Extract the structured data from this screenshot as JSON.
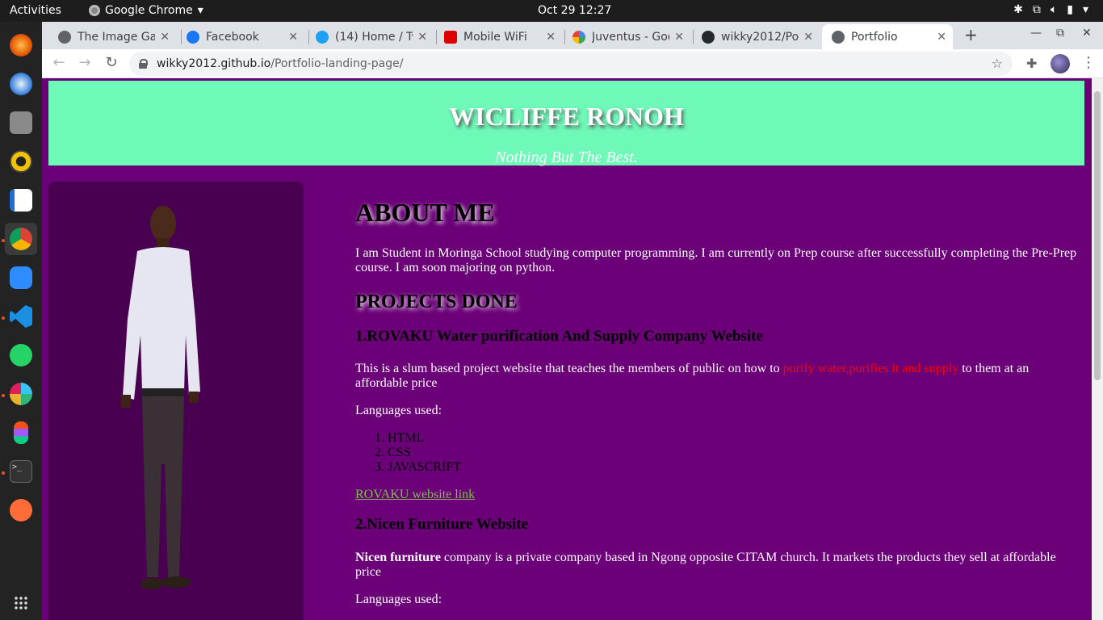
{
  "system": {
    "activities": "Activities",
    "app_name": "Google Chrome",
    "clock": "Oct 29  12:27"
  },
  "browser": {
    "tabs": [
      {
        "title": "The Image Gal",
        "favicon": "globe-icon"
      },
      {
        "title": "Facebook",
        "favicon": "facebook-icon"
      },
      {
        "title": "(14) Home / Tw",
        "favicon": "twitter-icon"
      },
      {
        "title": "Mobile WiFi",
        "favicon": "huawei-icon"
      },
      {
        "title": "Juventus - Goo",
        "favicon": "google-icon"
      },
      {
        "title": "wikky2012/Po",
        "favicon": "github-icon"
      },
      {
        "title": "Portfolio",
        "favicon": "globe-icon",
        "active": true
      }
    ],
    "url_host": "wikky2012.github.io",
    "url_path": "/Portfolio-landing-page/"
  },
  "page": {
    "header_title": "WICLIFFE RONOH",
    "header_tagline": "Nothing But The Best.",
    "about_heading": "ABOUT ME",
    "about_text": "I am Student in Moringa School studying computer programming. I am currently on Prep course after successfully completing the Pre-Prep course. I am soon majoring on python.",
    "projects_heading": "PROJECTS DONE",
    "project1": {
      "title": "1.ROVAKU Water purification And Supply Company Website",
      "desc_start": "This is a slum based project website that teaches the members of public on how to ",
      "desc_highlight": "purify water,purifies it and supply",
      "desc_end": " to them at an affordable price",
      "languages_label": "Languages used:",
      "languages": [
        "HTML",
        "CSS",
        "JAVASCRIPT"
      ],
      "link": "ROVAKU website link"
    },
    "project2": {
      "title": "2.Nicen Furniture Website",
      "desc_bold": "Nicen furniture",
      "desc_rest": " company is a private company based in Ngong opposite CITAM church. It markets the products they sell at affordable price",
      "languages_label": "Languages used:"
    }
  },
  "colors": {
    "page_bg": "#6b0078",
    "header_bg": "#6ef9b8",
    "photo_panel_bg": "#4a0051",
    "link": "#7cc04a",
    "highlight": "#ff0000"
  }
}
